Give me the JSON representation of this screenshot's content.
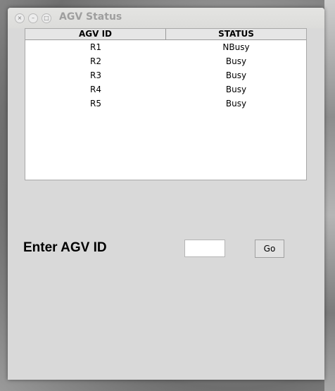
{
  "window": {
    "title": "AGV Status",
    "controls": {
      "close": "×",
      "minimize": "–",
      "maximize": "□"
    }
  },
  "table": {
    "columns": [
      "AGV ID",
      "STATUS"
    ],
    "rows": [
      {
        "id": "R1",
        "status": "NBusy"
      },
      {
        "id": "R2",
        "status": "Busy"
      },
      {
        "id": "R3",
        "status": "Busy"
      },
      {
        "id": "R4",
        "status": "Busy"
      },
      {
        "id": "R5",
        "status": "Busy"
      }
    ]
  },
  "form": {
    "label": "Enter AGV ID",
    "input_value": "",
    "go_label": "Go"
  }
}
